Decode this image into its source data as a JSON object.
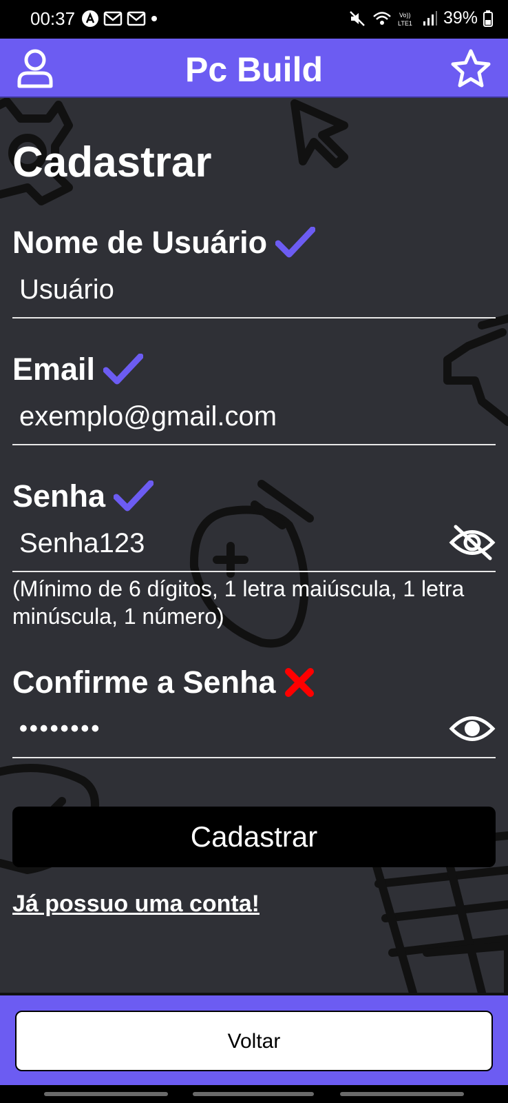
{
  "status_bar": {
    "time": "00:37",
    "battery": "39%"
  },
  "app_bar": {
    "title": "Pc Build"
  },
  "form": {
    "title": "Cadastrar",
    "username": {
      "label": "Nome de Usuário",
      "value": "Usuário",
      "valid": true
    },
    "email": {
      "label": "Email",
      "value": "exemplo@gmail.com",
      "valid": true
    },
    "password": {
      "label": "Senha",
      "value": "Senha123",
      "valid": true,
      "hint": "(Mínimo de 6 dígitos, 1 letra maiúscula, 1 letra minúscula, 1 número)"
    },
    "confirm_password": {
      "label": "Confirme a Senha",
      "value": "••••••••",
      "valid": false
    },
    "submit_label": "Cadastrar",
    "login_link": "Já possuo uma conta!"
  },
  "footer": {
    "back_label": "Voltar"
  },
  "colors": {
    "accent": "#6c5cf2",
    "background": "#2f3036",
    "valid_check": "#6c5cf2",
    "invalid_cross": "#ff0000"
  },
  "icons": [
    "profile-icon",
    "star-icon",
    "check-icon",
    "cross-icon",
    "eye-off-icon",
    "eye-icon"
  ]
}
